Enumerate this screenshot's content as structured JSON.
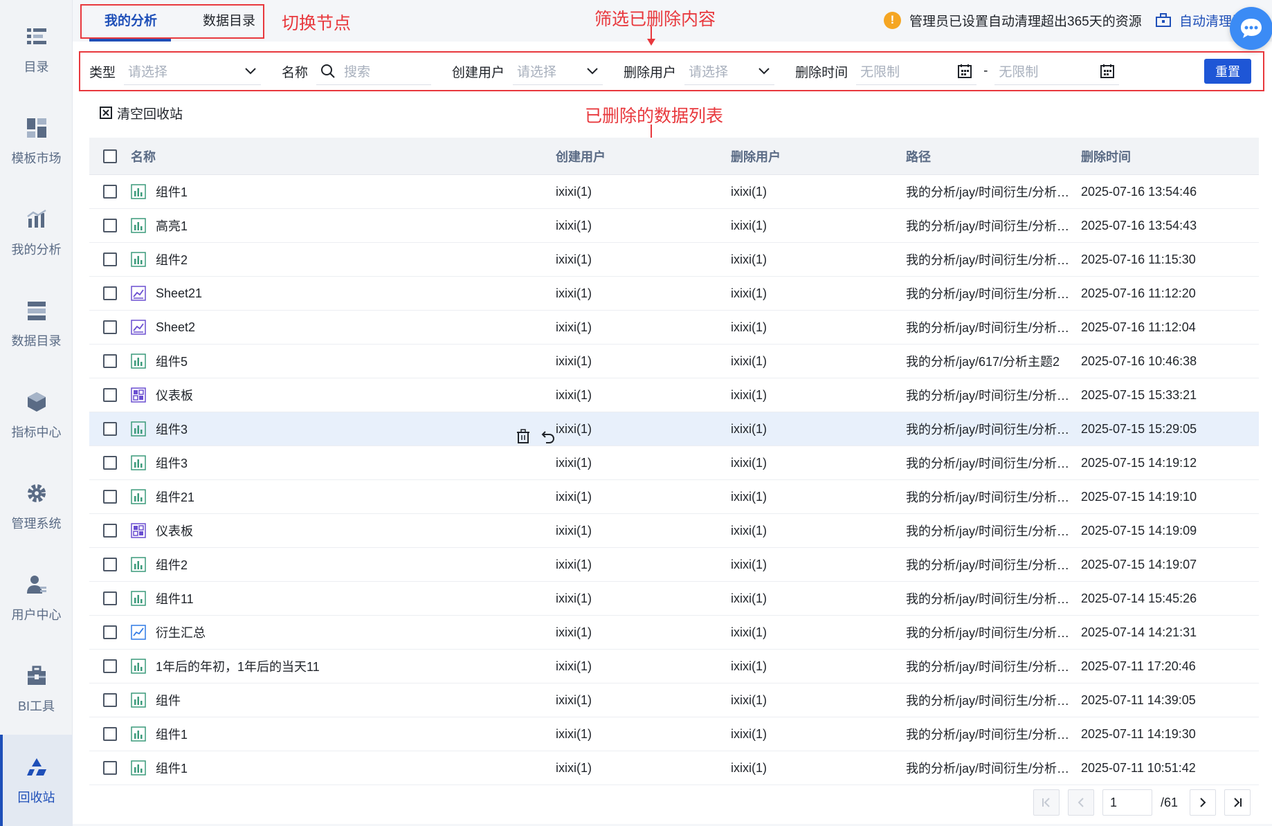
{
  "sidebar": {
    "items": [
      {
        "label": "目录",
        "icon": "list-icon"
      },
      {
        "label": "模板市场",
        "icon": "template-icon"
      },
      {
        "label": "我的分析",
        "icon": "analysis-icon"
      },
      {
        "label": "数据目录",
        "icon": "data-catalog-icon"
      },
      {
        "label": "指标中心",
        "icon": "metrics-icon"
      },
      {
        "label": "管理系统",
        "icon": "gear-icon"
      },
      {
        "label": "用户中心",
        "icon": "user-icon"
      },
      {
        "label": "BI工具",
        "icon": "toolbox-icon"
      },
      {
        "label": "回收站",
        "icon": "recycle-icon"
      }
    ],
    "active_index": 8
  },
  "tabs": [
    {
      "label": "我的分析",
      "active": true
    },
    {
      "label": "数据目录",
      "active": false
    }
  ],
  "annotations": {
    "switch_node": "切换节点",
    "filter_deleted": "筛选已删除内容",
    "deleted_list": "已删除的数据列表"
  },
  "notice": {
    "text": "管理员已设置自动清理超出365天的资源",
    "auto_clean": "自动清理设置"
  },
  "filters": {
    "type_label": "类型",
    "type_placeholder": "请选择",
    "name_label": "名称",
    "name_placeholder": "搜索",
    "creator_label": "创建用户",
    "creator_placeholder": "请选择",
    "deleter_label": "删除用户",
    "deleter_placeholder": "请选择",
    "time_label": "删除时间",
    "time_start": "无限制",
    "time_separator": "-",
    "time_end": "无限制",
    "reset": "重置"
  },
  "clear_recycle": "清空回收站",
  "table": {
    "headers": {
      "name": "名称",
      "creator": "创建用户",
      "deleter": "删除用户",
      "path": "路径",
      "time": "删除时间"
    },
    "rows": [
      {
        "name": "组件1",
        "icon": "bar-chart-icon",
        "creator": "ixixi(1)",
        "deleter": "ixixi(1)",
        "path": "我的分析/jay/时间衍生/分析主题",
        "time": "2025-07-16 13:54:46"
      },
      {
        "name": "高亮1",
        "icon": "bar-chart-icon",
        "creator": "ixixi(1)",
        "deleter": "ixixi(1)",
        "path": "我的分析/jay/时间衍生/分析主题",
        "time": "2025-07-16 13:54:43"
      },
      {
        "name": "组件2",
        "icon": "bar-chart-icon",
        "creator": "ixixi(1)",
        "deleter": "ixixi(1)",
        "path": "我的分析/jay/时间衍生/分析主题",
        "time": "2025-07-16 11:15:30"
      },
      {
        "name": "Sheet21",
        "icon": "sheet-icon",
        "creator": "ixixi(1)",
        "deleter": "ixixi(1)",
        "path": "我的分析/jay/时间衍生/分析主题",
        "time": "2025-07-16 11:12:20"
      },
      {
        "name": "Sheet2",
        "icon": "sheet-icon",
        "creator": "ixixi(1)",
        "deleter": "ixixi(1)",
        "path": "我的分析/jay/时间衍生/分析主题",
        "time": "2025-07-16 11:12:04"
      },
      {
        "name": "组件5",
        "icon": "bar-chart-icon",
        "creator": "ixixi(1)",
        "deleter": "ixixi(1)",
        "path": "我的分析/jay/617/分析主题2",
        "time": "2025-07-16 10:46:38"
      },
      {
        "name": "仪表板",
        "icon": "dashboard-icon",
        "creator": "ixixi(1)",
        "deleter": "ixixi(1)",
        "path": "我的分析/jay/时间衍生/分析主题",
        "time": "2025-07-15 15:33:21"
      },
      {
        "name": "组件3",
        "icon": "bar-chart-icon",
        "creator": "ixixi(1)",
        "deleter": "ixixi(1)",
        "path": "我的分析/jay/时间衍生/分析主题",
        "time": "2025-07-15 15:29:05",
        "hover": true
      },
      {
        "name": "组件3",
        "icon": "bar-chart-icon",
        "creator": "ixixi(1)",
        "deleter": "ixixi(1)",
        "path": "我的分析/jay/时间衍生/分析主题",
        "time": "2025-07-15 14:19:12"
      },
      {
        "name": "组件21",
        "icon": "bar-chart-icon",
        "creator": "ixixi(1)",
        "deleter": "ixixi(1)",
        "path": "我的分析/jay/时间衍生/分析主题",
        "time": "2025-07-15 14:19:10"
      },
      {
        "name": "仪表板",
        "icon": "dashboard-icon",
        "creator": "ixixi(1)",
        "deleter": "ixixi(1)",
        "path": "我的分析/jay/时间衍生/分析主题",
        "time": "2025-07-15 14:19:09"
      },
      {
        "name": "组件2",
        "icon": "bar-chart-icon",
        "creator": "ixixi(1)",
        "deleter": "ixixi(1)",
        "path": "我的分析/jay/时间衍生/分析主题",
        "time": "2025-07-15 14:19:07"
      },
      {
        "name": "组件11",
        "icon": "bar-chart-icon",
        "creator": "ixixi(1)",
        "deleter": "ixixi(1)",
        "path": "我的分析/jay/时间衍生/分析主题",
        "time": "2025-07-14 15:45:26"
      },
      {
        "name": "衍生汇总",
        "icon": "line-chart-icon",
        "creator": "ixixi(1)",
        "deleter": "ixixi(1)",
        "path": "我的分析/jay/时间衍生/分析主题",
        "time": "2025-07-14 14:21:31"
      },
      {
        "name": "1年后的年初，1年后的当天11",
        "icon": "bar-chart-icon",
        "creator": "ixixi(1)",
        "deleter": "ixixi(1)",
        "path": "我的分析/jay/时间衍生/分析主题",
        "time": "2025-07-11 17:20:46"
      },
      {
        "name": "组件",
        "icon": "bar-chart-icon",
        "creator": "ixixi(1)",
        "deleter": "ixixi(1)",
        "path": "我的分析/jay/时间衍生/分析主题",
        "time": "2025-07-11 14:39:05"
      },
      {
        "name": "组件1",
        "icon": "bar-chart-icon",
        "creator": "ixixi(1)",
        "deleter": "ixixi(1)",
        "path": "我的分析/jay/时间衍生/分析主题",
        "time": "2025-07-11 14:19:30"
      },
      {
        "name": "组件1",
        "icon": "bar-chart-icon",
        "creator": "ixixi(1)",
        "deleter": "ixixi(1)",
        "path": "我的分析/jay/时间衍生/分析主题",
        "time": "2025-07-11 10:51:42"
      }
    ]
  },
  "pagination": {
    "current": "1",
    "total": "/61"
  },
  "colors": {
    "accent": "#1e4fb8",
    "annotation": "#e8383d",
    "warning": "#f5a623",
    "hover_row": "#e8f0fb"
  }
}
